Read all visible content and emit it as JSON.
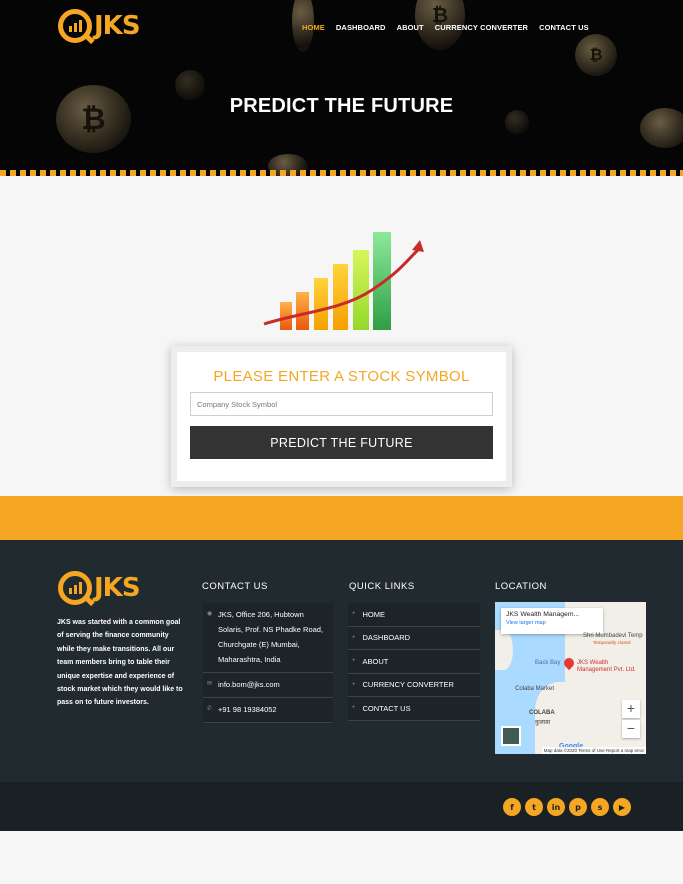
{
  "brand": {
    "logo_text": "JKS"
  },
  "nav": {
    "items": [
      {
        "label": "HOME",
        "active": true
      },
      {
        "label": "DASHBOARD"
      },
      {
        "label": "ABOUT"
      },
      {
        "label": "CURRENCY CONVERTER"
      },
      {
        "label": "CONTACT US"
      }
    ]
  },
  "hero": {
    "title": "PREDICT THE FUTURE"
  },
  "form": {
    "heading": "PLEASE ENTER A STOCK SYMBOL",
    "input_placeholder": "Company Stock Symbol",
    "submit_label": "PREDICT THE FUTURE"
  },
  "footer": {
    "about": "JKS was started with a common goal of serving the finance community while they make transitions. All our team members bring to table their unique expertise and experience of stock market which they would like to pass on to future investors.",
    "contact": {
      "heading": "CONTACT US",
      "address": "JKS, Office 206, Hubtown Solaris, Prof. NS Phadke Road, Churchgate (E) Mumbai, Maharashtra, India",
      "email": "info.bom@jks.com",
      "phone": "+91 98 19384052"
    },
    "quick_links": {
      "heading": "QUICK LINKS",
      "items": [
        "HOME",
        "DASHBOARD",
        "ABOUT",
        "CURRENCY CONVERTER",
        "CONTACT US"
      ]
    },
    "location": {
      "heading": "LOCATION",
      "map_place": "JKS Wealth Managem...",
      "map_link": "View larger map",
      "pin_label": "JKS Wealth Management Pvt. Ltd.",
      "labels": [
        "Shri Mumbadevi Temp",
        "Temporarily closed",
        "Back Bay",
        "Colaba Market",
        "COLABA",
        "कुलाबा"
      ],
      "attribution": "Map data ©2020   Terms of Use   Report a map error",
      "google": "Google"
    },
    "social": [
      "f",
      "t",
      "in",
      "p",
      "s",
      "▶"
    ]
  },
  "colors": {
    "accent": "#f5a623",
    "footer_bg": "#212a2f",
    "button_bg": "#333333"
  }
}
